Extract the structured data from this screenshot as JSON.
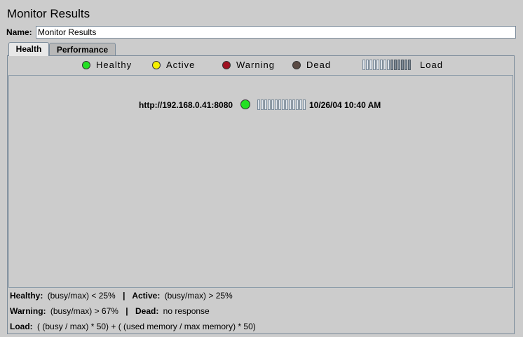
{
  "window": {
    "title": "Monitor Results"
  },
  "name_field": {
    "label": "Name:",
    "value": "Monitor Results"
  },
  "tabs": [
    {
      "label": "Health",
      "selected": true
    },
    {
      "label": "Performance",
      "selected": false
    }
  ],
  "legend": {
    "items": [
      {
        "label": "Healthy",
        "color": "#22e022"
      },
      {
        "label": "Active",
        "color": "#f5f000"
      },
      {
        "label": "Warning",
        "color": "#a01020"
      },
      {
        "label": "Dead",
        "color": "#5a4a44"
      }
    ],
    "load_label": "Load"
  },
  "servers": [
    {
      "url": "http://192.168.0.41:8080",
      "status": "Healthy",
      "status_color": "#22e022",
      "load_fraction": 0,
      "timestamp": "10/26/04 10:40 AM"
    }
  ],
  "footer": {
    "healthy_label": "Healthy:",
    "healthy_rule": "(busy/max) < 25%",
    "active_label": "Active:",
    "active_rule": "(busy/max) > 25%",
    "warning_label": "Warning:",
    "warning_rule": "(busy/max) > 67%",
    "dead_label": "Dead:",
    "dead_rule": "no response",
    "load_label": "Load:",
    "load_rule": "( (busy / max) * 50) + ( (used memory / max memory) * 50)",
    "separator": "|"
  }
}
